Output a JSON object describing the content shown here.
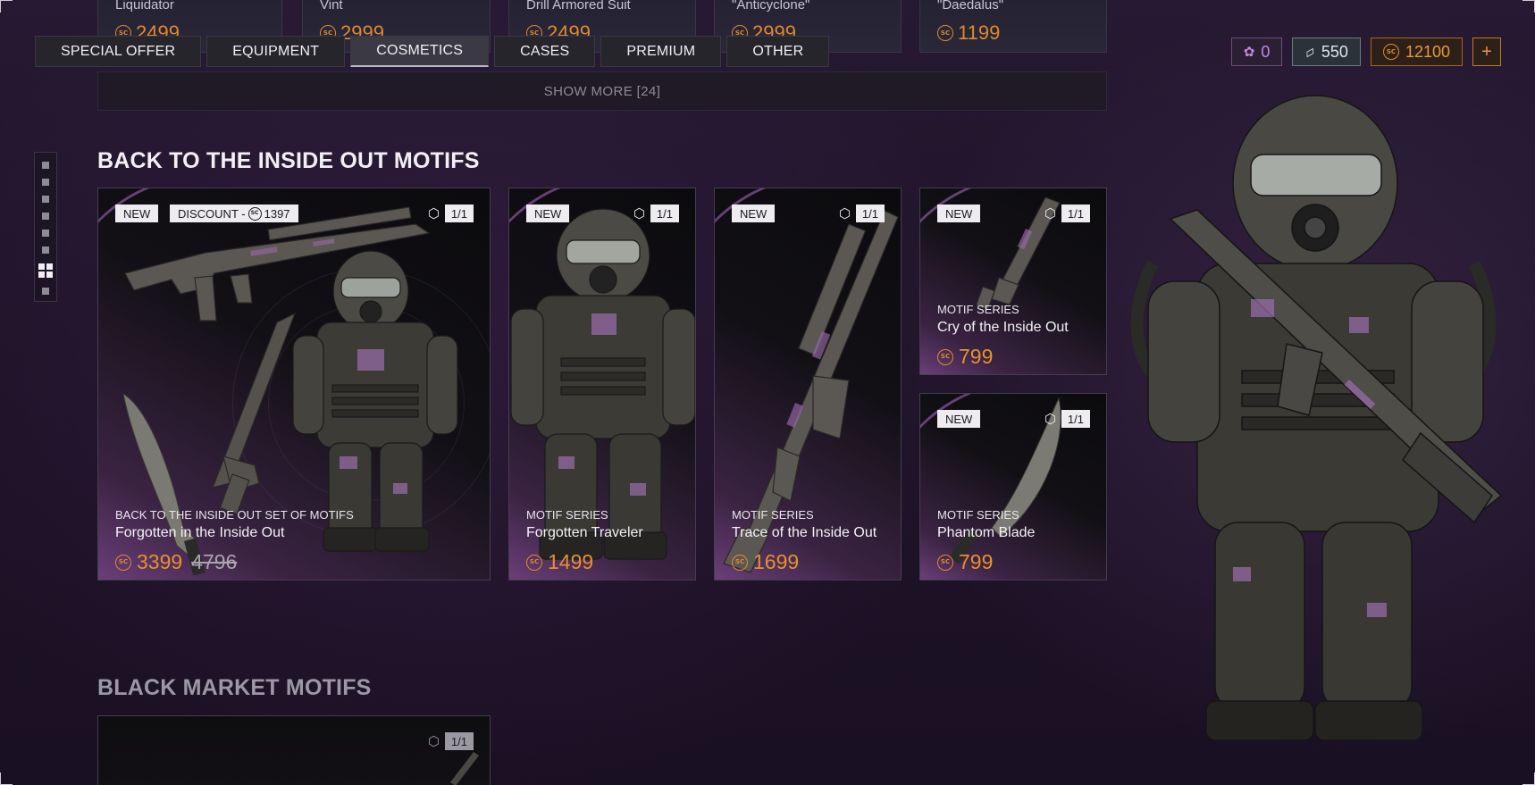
{
  "top_cards": [
    {
      "name": "Liquidator",
      "price": "2499"
    },
    {
      "name": "Vint",
      "price": "2999"
    },
    {
      "name": "Drill Armored Suit",
      "price": "2499"
    },
    {
      "name": "\"Anticyclone\"",
      "price": "2999"
    },
    {
      "name": "\"Daedalus\"",
      "price": "1199"
    }
  ],
  "tabs": [
    {
      "label": "SPECIAL OFFER",
      "active": false
    },
    {
      "label": "EQUIPMENT",
      "active": false
    },
    {
      "label": "COSMETICS",
      "active": true
    },
    {
      "label": "CASES",
      "active": false
    },
    {
      "label": "PREMIUM",
      "active": false
    },
    {
      "label": "OTHER",
      "active": false
    }
  ],
  "currencies": {
    "motif": {
      "icon": "motif-flower-icon",
      "value": "0"
    },
    "ticket": {
      "icon": "ticket-icon",
      "value": "550"
    },
    "sc": {
      "icon": "sc-coin-icon",
      "value": "12100"
    },
    "add_label": "+"
  },
  "coin_symbol": "SC",
  "show_more": "SHOW MORE [24]",
  "sections": {
    "inside_out": "BACK TO THE INSIDE OUT MOTIFS",
    "black_market": "BLACK MARKET MOTIFS"
  },
  "products": [
    {
      "new": "NEW",
      "discount_label": "DISCOUNT -",
      "discount_value": "1397",
      "qty": "1/1",
      "series": "BACK TO THE INSIDE OUT SET OF MOTIFS",
      "name": "Forgotten in the Inside Out",
      "price": "3399",
      "old_price": "4796"
    },
    {
      "new": "NEW",
      "qty": "1/1",
      "series": "MOTIF SERIES",
      "name": "Forgotten Traveler",
      "price": "1499"
    },
    {
      "new": "NEW",
      "qty": "1/1",
      "series": "MOTIF SERIES",
      "name": "Trace of the Inside Out",
      "price": "1699"
    },
    {
      "new": "NEW",
      "qty": "1/1",
      "series": "MOTIF SERIES",
      "name": "Cry of the Inside Out",
      "price": "799"
    },
    {
      "new": "NEW",
      "qty": "1/1",
      "series": "MOTIF SERIES",
      "name": "Phantom Blade",
      "price": "799"
    }
  ],
  "black_market_card": {
    "qty": "1/1"
  },
  "colors": {
    "price_orange": "#e5912f",
    "background": "#1e1328",
    "accent_purple": "#6a3f78"
  }
}
